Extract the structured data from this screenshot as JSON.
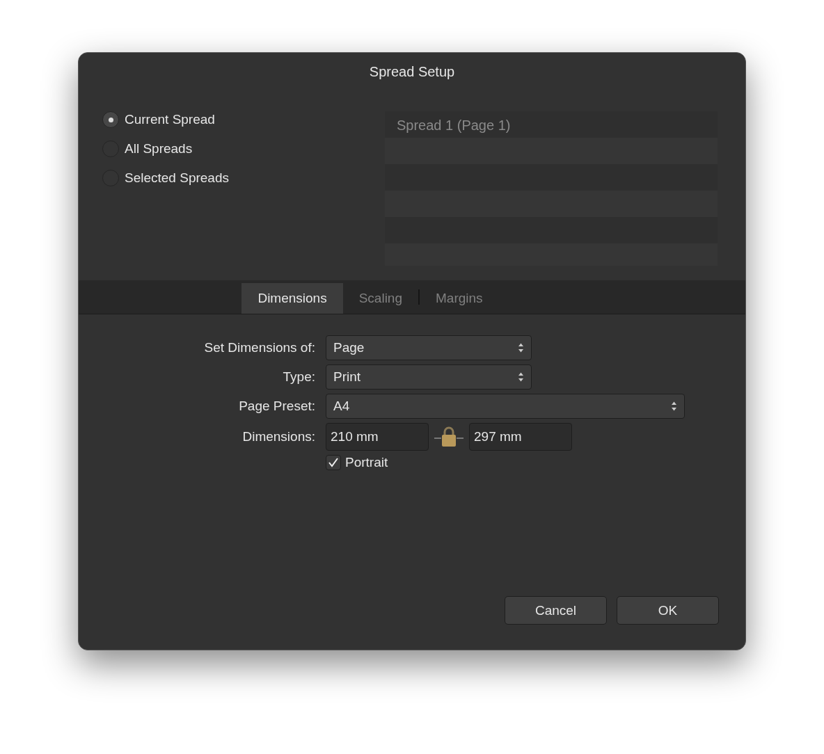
{
  "window": {
    "title": "Spread Setup"
  },
  "spread_options": [
    {
      "label": "Current Spread",
      "selected": true
    },
    {
      "label": "All Spreads",
      "selected": false
    },
    {
      "label": "Selected Spreads",
      "selected": false
    }
  ],
  "spread_list": {
    "rows": [
      "Spread 1 (Page 1)"
    ]
  },
  "tabs": [
    {
      "label": "Dimensions",
      "selected": true
    },
    {
      "label": "Scaling",
      "selected": false
    },
    {
      "label": "Margins",
      "selected": false
    }
  ],
  "fields": [
    {
      "kind": "select",
      "label": "Set Dimensions of:",
      "value": "Page"
    },
    {
      "kind": "select",
      "label": "Type:",
      "value": "Print"
    },
    {
      "kind": "wide-select",
      "label": "Page Preset:",
      "value": "A4"
    },
    {
      "kind": "dimensions",
      "label": "Dimensions:",
      "width": "210 mm",
      "height": "297 mm",
      "locked": true
    },
    {
      "kind": "checkbox",
      "label": "Portrait",
      "checked": true
    }
  ],
  "buttons": [
    "Cancel",
    "OK"
  ]
}
